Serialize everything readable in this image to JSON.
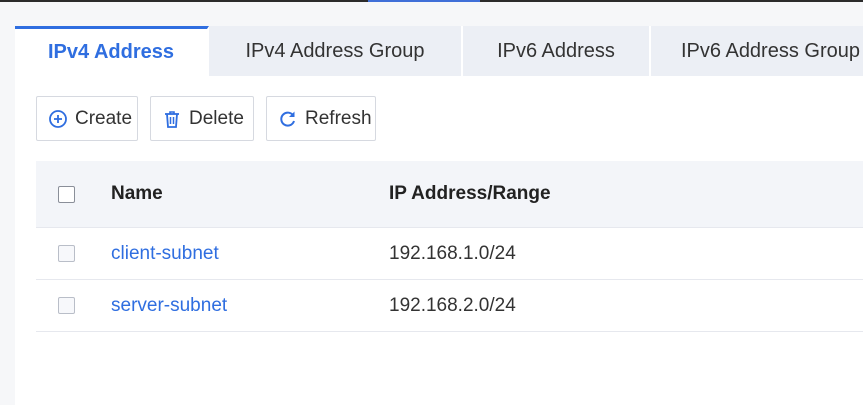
{
  "tabs": [
    {
      "label": "IPv4 Address",
      "active": true
    },
    {
      "label": "IPv4 Address Group",
      "active": false
    },
    {
      "label": "IPv6 Address",
      "active": false
    },
    {
      "label": "IPv6 Address Group",
      "active": false
    }
  ],
  "toolbar": {
    "create_label": "Create",
    "create_icon": "plus-circle-icon",
    "delete_label": "Delete",
    "delete_icon": "trash-icon",
    "refresh_label": "Refresh",
    "refresh_icon": "refresh-icon"
  },
  "table": {
    "headers": {
      "name": "Name",
      "ip": "IP Address/Range"
    },
    "rows": [
      {
        "name": "client-subnet",
        "ip": "192.168.1.0/24"
      },
      {
        "name": "server-subnet",
        "ip": "192.168.2.0/24"
      }
    ]
  },
  "colors": {
    "accent": "#2f6ee0",
    "tab_inactive": "#eceff5",
    "header_bg": "#f3f5f9"
  }
}
